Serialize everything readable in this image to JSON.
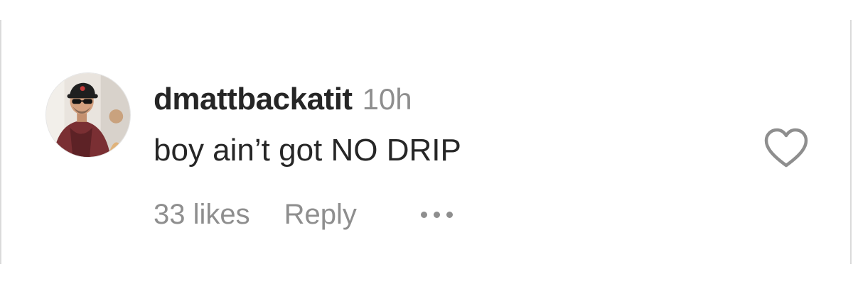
{
  "comment": {
    "username": "dmattbackatit",
    "timestamp": "10h",
    "text": "boy ain’t got NO DRIP",
    "likes": "33 likes",
    "reply_label": "Reply",
    "more_icon": "ellipsis-icon",
    "like_icon": "heart-outline-icon",
    "avatar": "profile-photo"
  },
  "colors": {
    "text_primary": "#262626",
    "text_secondary": "#8e8e8e",
    "border": "#dbdbdb"
  }
}
